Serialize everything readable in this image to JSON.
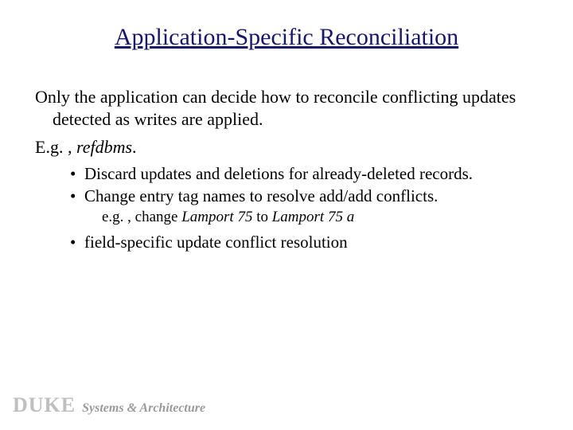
{
  "title": "Application-Specific Reconciliation",
  "para1": "Only the application can decide how to reconcile conflicting updates detected as writes are applied.",
  "eg_prefix": "E.g. , ",
  "eg_ital": "refdbms",
  "eg_suffix": ".",
  "bullet1": "Discard updates and deletions for already-deleted records.",
  "bullet2": "Change entry tag names to resolve add/add conflicts.",
  "sub_prefix": "e.g. , change ",
  "sub_ital1": "Lamport 75",
  "sub_mid": " to ",
  "sub_ital2": "Lamport 75 a",
  "bullet3": "field-specific update conflict resolution",
  "footer_duke": "DUKE",
  "footer_sysarch": "Systems & Architecture"
}
